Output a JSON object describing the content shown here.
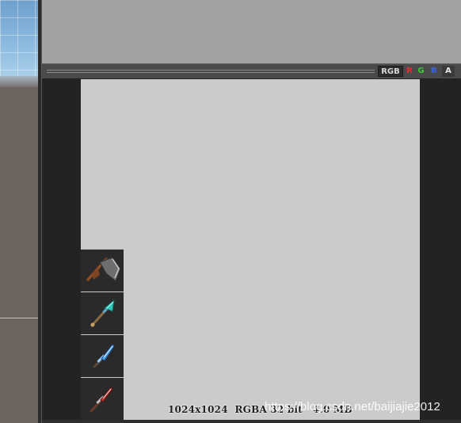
{
  "channels": {
    "rgb": "RGB",
    "r": "R",
    "g": "G",
    "b": "B",
    "a": "A"
  },
  "preview": {
    "info_text": "1024x1024  RGBA 32 bit   4.0 MB",
    "sprites": [
      "axe-icon",
      "spear-teal-icon",
      "dagger-blue-icon",
      "dagger-red-icon"
    ]
  },
  "watermark": "https://blog.csdn.net/baijiajie2012",
  "colors": {
    "channel_r": "#e0302a",
    "channel_g": "#3cc63c",
    "channel_b": "#3a64e8",
    "texture_bg": "#cbcbcb",
    "preview_bg": "#232323"
  }
}
